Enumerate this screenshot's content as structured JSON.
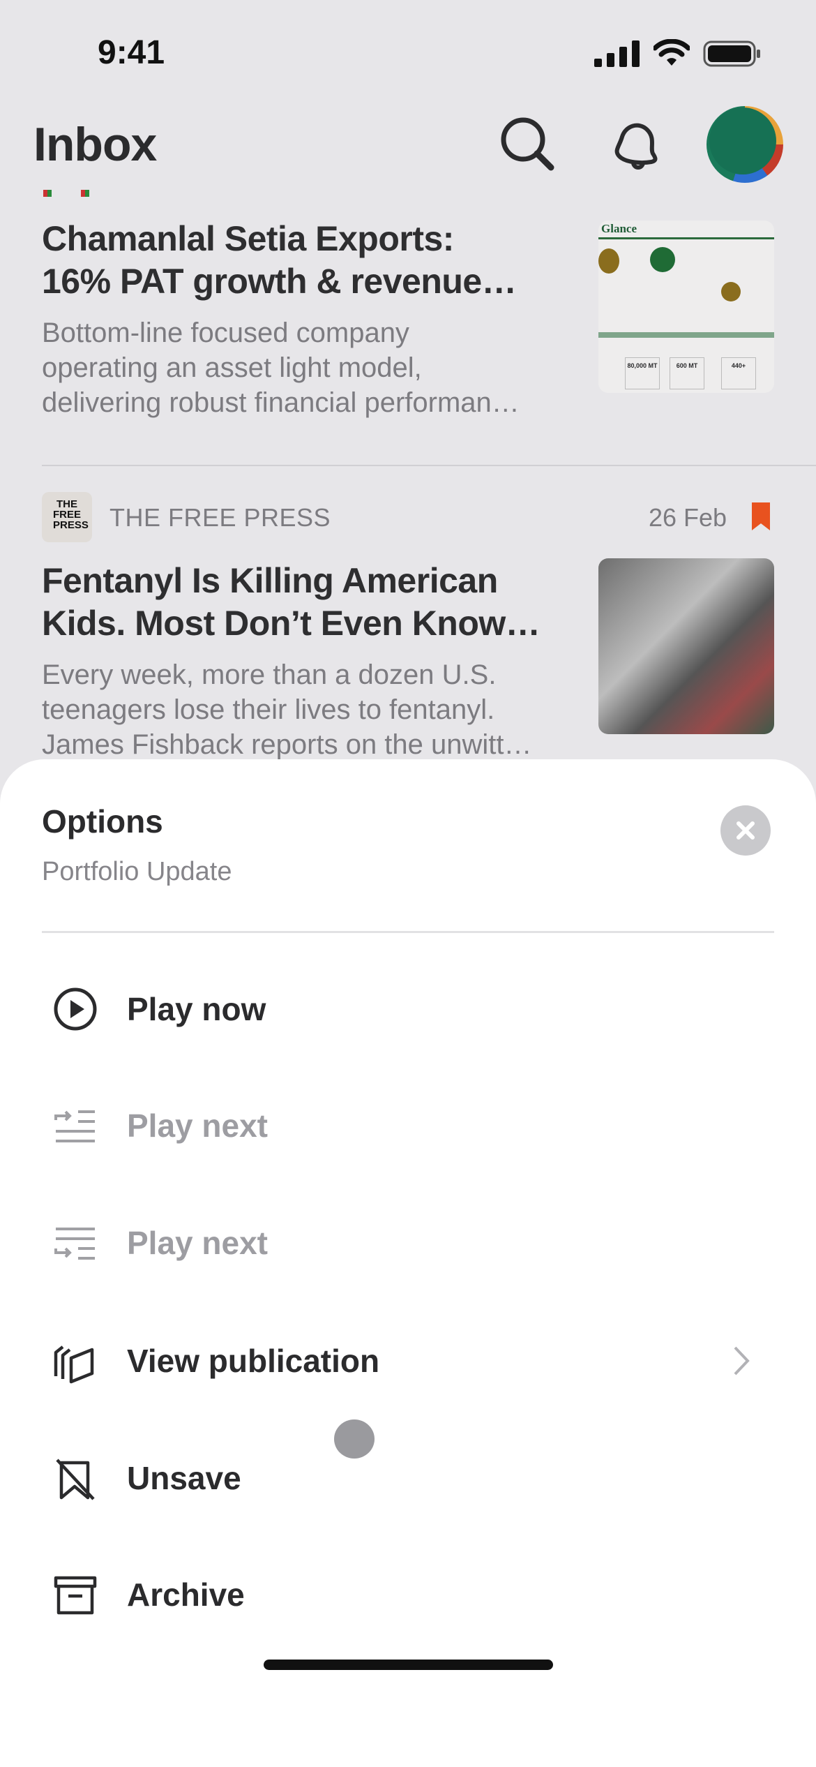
{
  "status": {
    "time": "9:41"
  },
  "header": {
    "title": "Inbox"
  },
  "articles": [
    {
      "title": [
        "Chamanlal Setia Exports:",
        "16% PAT growth & revenue…"
      ],
      "body": [
        "Bottom-line focused company",
        "operating an asset light model,",
        "delivering robust financial performan…"
      ],
      "thumb": {
        "heading": "Glance",
        "stats": [
          "80,000 MT",
          "600 MT",
          "440+"
        ]
      }
    },
    {
      "publication": "THE FREE PRESS",
      "logo": "THE FREE PRESS",
      "date": "26 Feb",
      "saved": true,
      "title": [
        "Fentanyl Is Killing American",
        "Kids. Most Don’t Even Know…"
      ],
      "body": [
        "Every week, more than a dozen U.S.",
        "teenagers lose their lives to fentanyl.",
        "James Fishback reports on the unwitt…"
      ]
    }
  ],
  "sheet": {
    "title": "Options",
    "subtitle": "Portfolio Update",
    "items": [
      {
        "label": "Play now",
        "icon": "play-circle-icon",
        "enabled": true
      },
      {
        "label": "Play next",
        "icon": "play-next-icon",
        "enabled": false
      },
      {
        "label": "Play next",
        "icon": "play-last-icon",
        "enabled": false
      },
      {
        "label": "View publication",
        "icon": "publication-icon",
        "enabled": true,
        "chevron": true
      },
      {
        "label": "Unsave",
        "icon": "unsave-bookmark-icon",
        "enabled": true
      },
      {
        "label": "Archive",
        "icon": "archive-icon",
        "enabled": true
      }
    ]
  },
  "colors": {
    "accent": "#e8521f",
    "background": "#e7e6e9",
    "sheet": "#ffffff"
  }
}
